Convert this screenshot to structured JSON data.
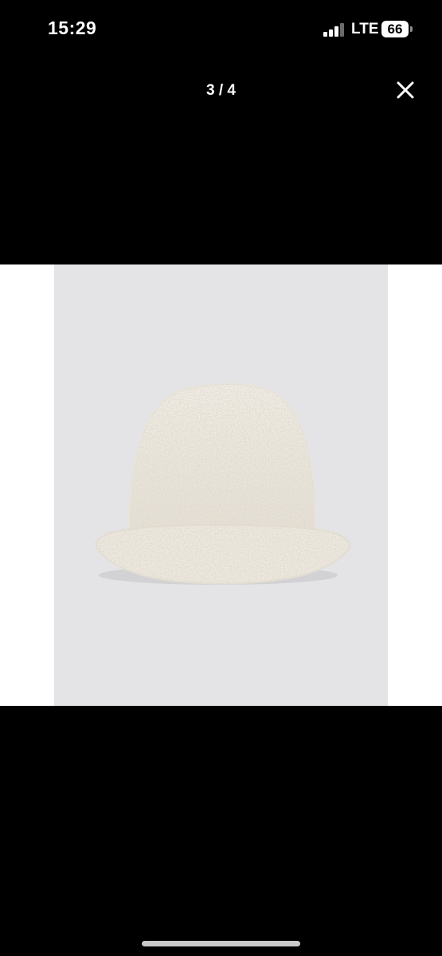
{
  "status_bar": {
    "time": "15:29",
    "network": "LTE",
    "battery": "66",
    "icons": [
      "signal-icon",
      "battery-icon"
    ]
  },
  "viewer": {
    "page_indicator": "3 / 4",
    "close_icon": "close-icon"
  },
  "photo": {
    "subject": "cream sherpa bucket hat",
    "background_color": "#e4e4e6",
    "hat_color": "#f1ede5"
  }
}
